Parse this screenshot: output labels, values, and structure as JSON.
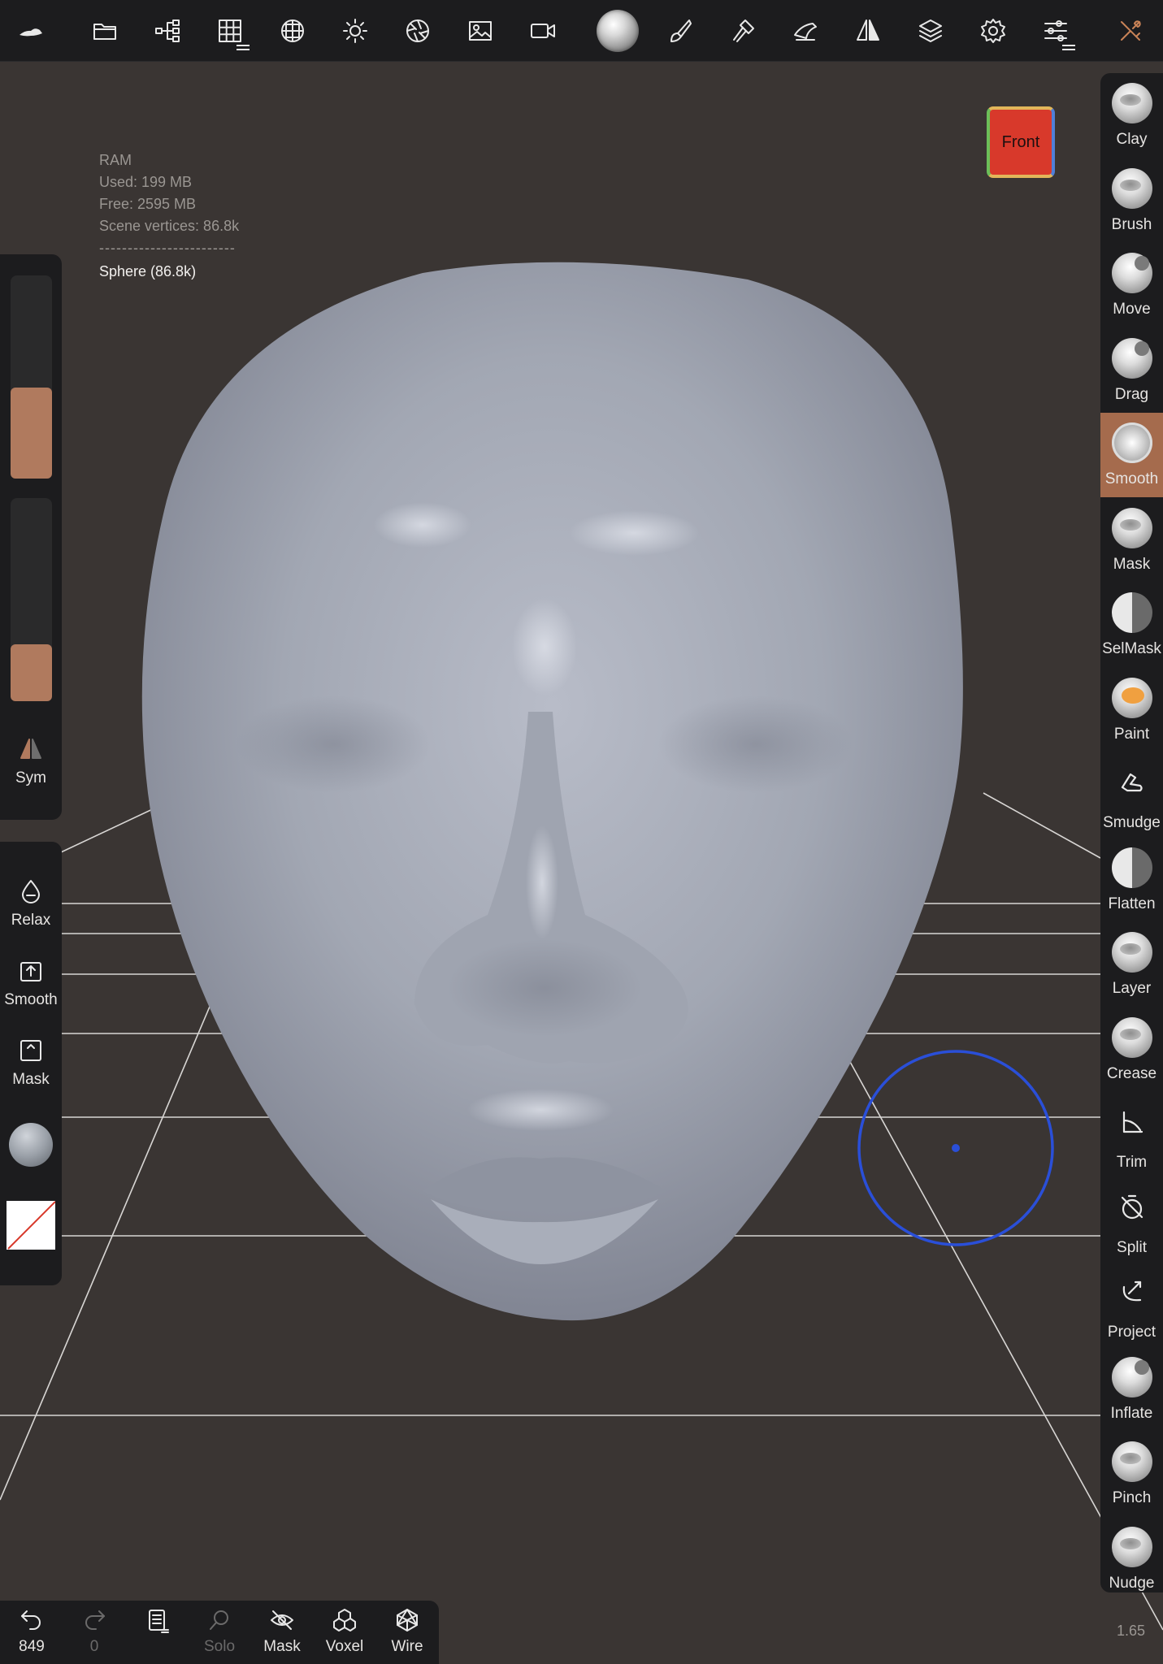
{
  "toolbar": {
    "icons": [
      "logo-icon",
      "folder-icon",
      "scene-tree-icon",
      "topology-grid-icon",
      "multires-sphere-icon",
      "lighting-icon",
      "material-icon",
      "background-image-icon",
      "camera-icon",
      "brush-preview-icon",
      "painting-icon",
      "stroke-icon",
      "symmetry-tool-icon",
      "mirror-icon",
      "layers-icon",
      "settings-icon",
      "sliders-icon",
      "tools-icon"
    ]
  },
  "stats": {
    "ram_label": "RAM",
    "used": "Used: 199 MB",
    "free": "Free: 2595 MB",
    "vertices": "Scene vertices: 86.8k",
    "separator": "------------------------",
    "object": "Sphere (86.8k)"
  },
  "view_cube": {
    "label": "Front"
  },
  "left_panel": {
    "radius_fill": 0.45,
    "intensity_fill": 0.28,
    "sym_label": "Sym",
    "buttons": [
      {
        "label": "Relax",
        "icon": "drop-icon"
      },
      {
        "label": "Smooth",
        "icon": "box-arrow-up-icon"
      },
      {
        "label": "Mask",
        "icon": "box-caret-icon"
      }
    ]
  },
  "tools": [
    {
      "label": "Clay",
      "icon": "ball-dent"
    },
    {
      "label": "Brush",
      "icon": "ball-dent"
    },
    {
      "label": "Move",
      "icon": "ball-bump"
    },
    {
      "label": "Drag",
      "icon": "ball-bump"
    },
    {
      "label": "Smooth",
      "icon": "ball-spiky",
      "active": true
    },
    {
      "label": "Mask",
      "icon": "ball-dent"
    },
    {
      "label": "SelMask",
      "icon": "ball-half"
    },
    {
      "label": "Paint",
      "icon": "ball-paint"
    },
    {
      "label": "Smudge",
      "icon": "smudge-icon"
    },
    {
      "label": "Flatten",
      "icon": "ball-half"
    },
    {
      "label": "Layer",
      "icon": "ball-dent"
    },
    {
      "label": "Crease",
      "icon": "ball-dent"
    },
    {
      "label": "Trim",
      "icon": "trim-icon"
    },
    {
      "label": "Split",
      "icon": "split-icon"
    },
    {
      "label": "Project",
      "icon": "project-icon"
    },
    {
      "label": "Inflate",
      "icon": "ball-bump"
    },
    {
      "label": "Pinch",
      "icon": "ball-dent"
    },
    {
      "label": "Nudge",
      "icon": "ball-dent"
    }
  ],
  "bottom_bar": {
    "undo_count": "849",
    "redo_count": "0",
    "solo": "Solo",
    "mask": "Mask",
    "voxel": "Voxel",
    "wire": "Wire"
  },
  "zoom": "1.65",
  "colors": {
    "accent": "#a56b4d",
    "brush_cursor": "#2a4fd8",
    "background": "#3a3533"
  }
}
